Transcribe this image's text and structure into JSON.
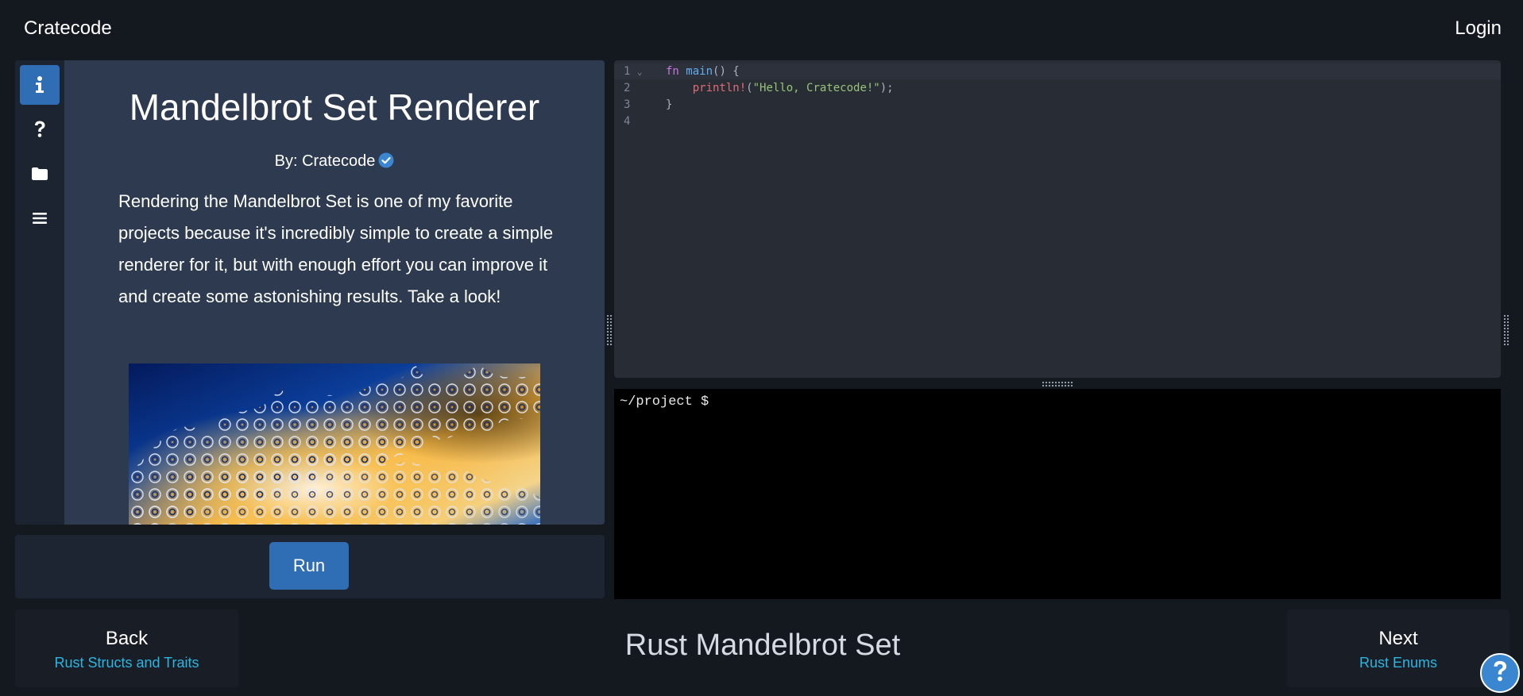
{
  "header": {
    "brand": "Cratecode",
    "login": "Login"
  },
  "sidebar": {
    "items": [
      {
        "icon": "info-icon",
        "active": true
      },
      {
        "icon": "question-icon",
        "active": false
      },
      {
        "icon": "folder-icon",
        "active": false
      },
      {
        "icon": "menu-icon",
        "active": false
      }
    ]
  },
  "lesson": {
    "title": "Mandelbrot Set Renderer",
    "by_prefix": "By: ",
    "author": "Cratecode",
    "description": "Rendering the Mandelbrot Set is one of my favorite projects because it's incredibly simple to create a simple renderer for it, but with enough effort you can improve it and create some astonishing results. Take a look!"
  },
  "run_button": "Run",
  "editor": {
    "line_numbers": [
      "1",
      "2",
      "3",
      "4"
    ],
    "fold_marker": "⌄",
    "code": {
      "l1_kw": "fn",
      "l1_name": "main",
      "l1_rest": "() {",
      "l2_indent": "    ",
      "l2_macro": "println!",
      "l2_open": "(",
      "l2_string": "\"Hello, Cratecode!\"",
      "l2_close": ");",
      "l3": "}",
      "l4": ""
    }
  },
  "terminal": {
    "prompt": "~/project $"
  },
  "footer": {
    "back_label": "Back",
    "back_target": "Rust Structs and Traits",
    "course_title": "Rust Mandelbrot Set",
    "next_label": "Next",
    "next_target": "Rust Enums"
  },
  "colors": {
    "background": "#14181f",
    "accent": "#2f6db5",
    "link": "#2bb5e0",
    "panel": "#2d3a4f"
  }
}
